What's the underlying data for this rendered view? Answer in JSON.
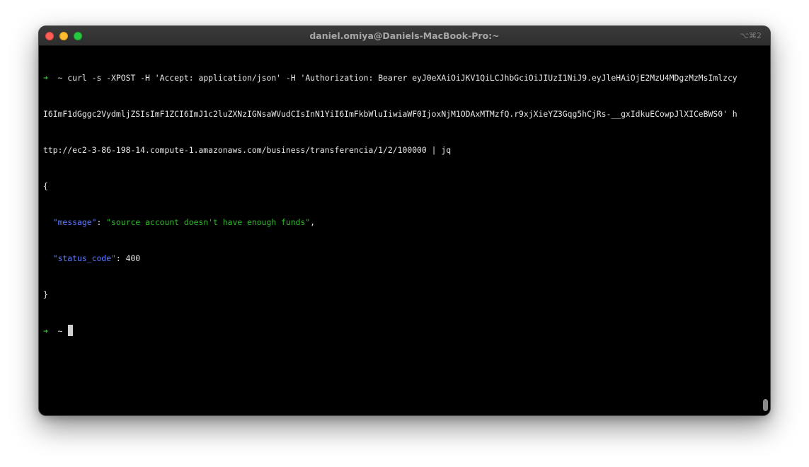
{
  "window": {
    "title": "daniel.omiya@Daniels-MacBook-Pro:~",
    "shortcut": "⌥⌘2"
  },
  "terminal": {
    "prompt_arrow": "➜",
    "prompt_dir": "~",
    "command_lines": [
      "curl -s -XPOST -H 'Accept: application/json' -H 'Authorization: Bearer eyJ0eXAiOiJKV1QiLCJhbGciOiJIUzI1NiJ9.eyJleHAiOjE2MzU4MDgzMzMsImlzcy",
      "I6ImF1dGggc2VydmljZSIsImF1ZCI6ImJ1c2luZXNzIGNsaWVudCIsInN1YiI6ImFkbWluIiwiaWF0IjoxNjM1ODAxMTMzfQ.r9xjXieYZ3Gqg5hCjRs-__gxIdkuECowpJlXICeBWS0' h",
      "ttp://ec2-3-86-198-14.compute-1.amazonaws.com/business/transferencia/1/2/100000 | jq"
    ],
    "json_open": "{",
    "json_close": "}",
    "entries": [
      {
        "key": "\"message\"",
        "value": "\"source account doesn't have enough funds\"",
        "sep": ": ",
        "trail": ","
      },
      {
        "key": "\"status_code\"",
        "value": "400",
        "sep": ": ",
        "trail": ""
      }
    ]
  },
  "colors": {
    "prompt_arrow": "#33cc33",
    "json_key": "#5a78ff",
    "json_string": "#31b92c",
    "background": "#000000"
  }
}
